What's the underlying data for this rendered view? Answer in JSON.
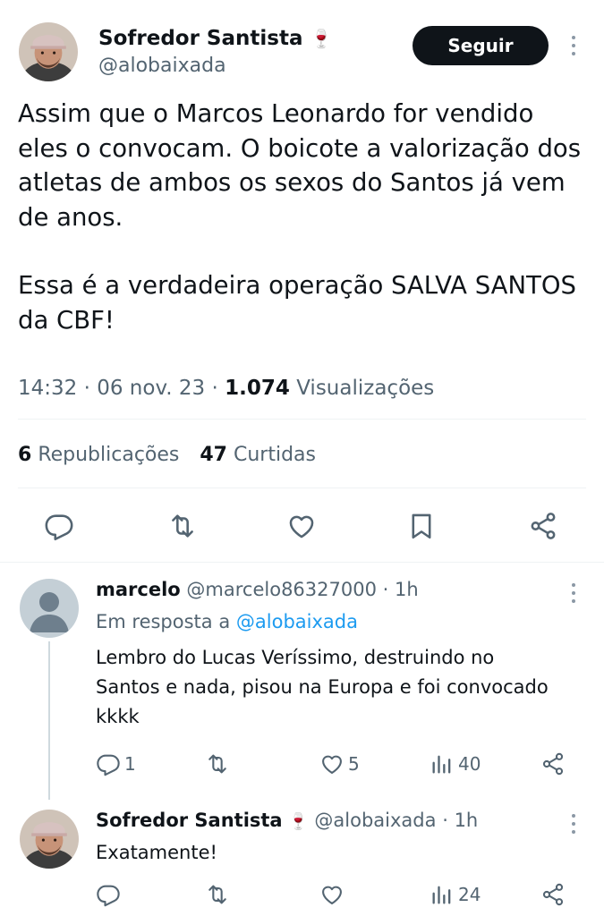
{
  "main_tweet": {
    "author_name": "Sofredor Santista",
    "author_emoji": "🍷",
    "handle": "@alobaixada",
    "follow_label": "Seguir",
    "text_paragraphs": [
      "Assim que o Marcos Leonardo for vendido eles o convocam. O boicote a valorização dos atletas de ambos os sexos do Santos já vem de anos.",
      "Essa é a verdadeira operação SALVA SANTOS da CBF!"
    ],
    "time": "14:32",
    "date": "06 nov. 23",
    "views_count": "1.074",
    "views_label": "Visualizações",
    "reposts_count": "6",
    "reposts_label": "Republicações",
    "likes_count": "47",
    "likes_label": "Curtidas"
  },
  "reply1": {
    "author_name": "marcelo",
    "handle": "@marcelo86327000",
    "time": "1h",
    "reply_to_prefix": "Em resposta a",
    "reply_to_handle": "@alobaixada",
    "text": "Lembro do Lucas Veríssimo, destruindo no Santos e nada, pisou na Europa e foi convocado kkkk",
    "reply_count": "1",
    "like_count": "5",
    "view_count": "40"
  },
  "reply2": {
    "author_name": "Sofredor Santista",
    "author_emoji": "🍷",
    "handle": "@alobaixada",
    "time": "1h",
    "text": "Exatamente!",
    "view_count": "24"
  },
  "separator": "·",
  "colors": {
    "text": "#0f1419",
    "muted": "#536471",
    "link": "#1d9bf0",
    "button_bg": "#0f1419",
    "divider": "#eff3f4"
  }
}
